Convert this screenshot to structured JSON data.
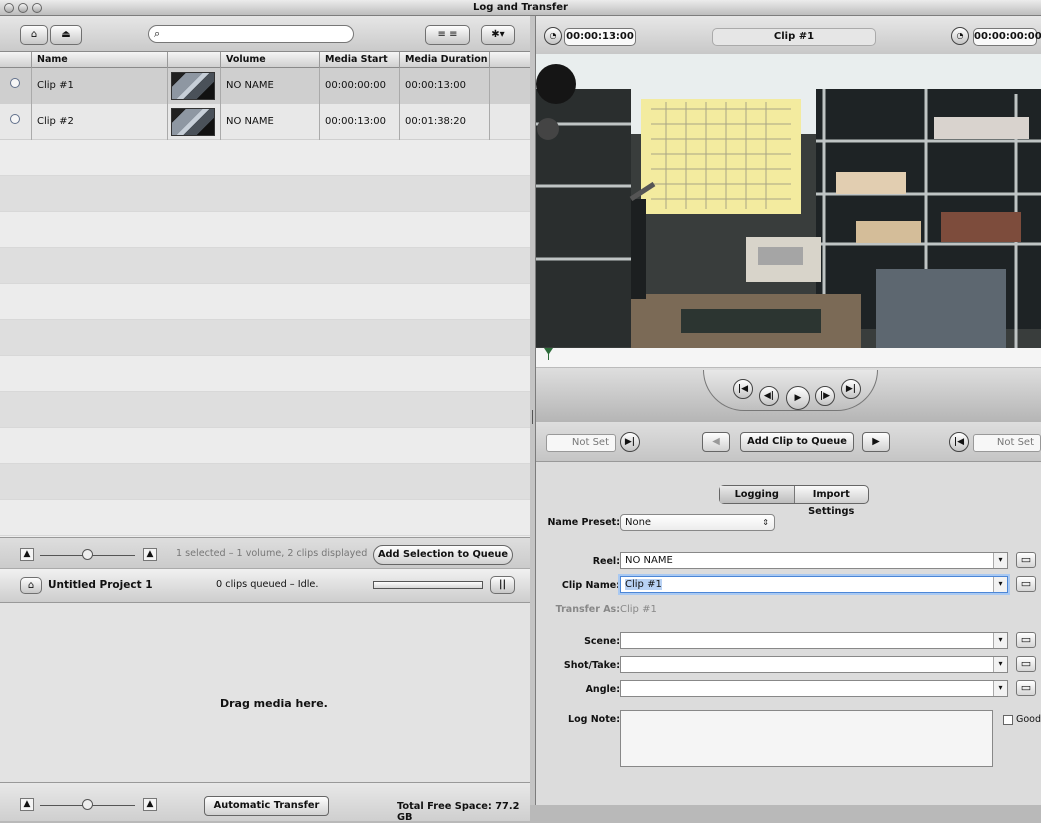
{
  "window": {
    "title": "Log and Transfer"
  },
  "toolbar": {
    "search_placeholder": ""
  },
  "clips": {
    "columns": [
      "",
      "Name",
      "",
      "Volume",
      "Media Start",
      "Media Duration"
    ],
    "rows": [
      {
        "name": "Clip #1",
        "volume": "NO NAME",
        "media_start": "00:00:00:00",
        "media_duration": "00:00:13:00"
      },
      {
        "name": "Clip #2",
        "volume": "NO NAME",
        "media_start": "00:00:13:00",
        "media_duration": "00:01:38:20"
      }
    ]
  },
  "status": {
    "selection_text": "1 selected – 1 volume, 2 clips displayed",
    "add_selection_button": "Add Selection to Queue"
  },
  "project": {
    "name": "Untitled Project 1",
    "queue_status": "0 clips queued – Idle.",
    "drop_text": "Drag media here."
  },
  "footer": {
    "automatic_transfer_button": "Automatic Transfer",
    "free_space": "Total Free Space: 77.2 GB"
  },
  "viewer": {
    "in_timecode": "00:00:13:00",
    "clip_title": "Clip #1",
    "out_timecode": "00:00:00:00"
  },
  "queue_controls": {
    "in_not_set": "Not Set",
    "out_not_set": "Not Set",
    "add_clip_button": "Add Clip to Queue"
  },
  "tabs": {
    "logging": "Logging",
    "import_settings": "Import Settings"
  },
  "form": {
    "name_preset_label": "Name Preset:",
    "name_preset_value": "None",
    "reel_label": "Reel:",
    "reel_value": "NO NAME",
    "clip_name_label": "Clip Name:",
    "clip_name_value": "Clip #1",
    "transfer_as_label": "Transfer As:",
    "transfer_as_value": "Clip #1",
    "scene_label": "Scene:",
    "shot_take_label": "Shot/Take:",
    "angle_label": "Angle:",
    "log_note_label": "Log Note:",
    "good_label": "Good"
  }
}
